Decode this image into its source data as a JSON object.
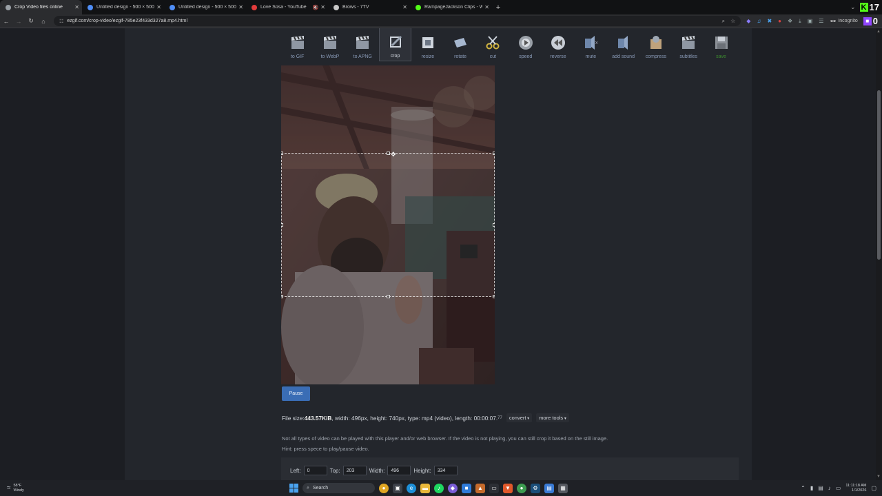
{
  "tabs": [
    {
      "label": "Crop Video files online",
      "favicon_color": "#9aa0a6",
      "active": true,
      "muted": false
    },
    {
      "label": "Untitled design - 500 × 500px",
      "favicon_color": "#4f8ef7",
      "active": false,
      "muted": false
    },
    {
      "label": "Untitled design - 500 × 500px",
      "favicon_color": "#4f8ef7",
      "active": false,
      "muted": false
    },
    {
      "label": "Love Sosa - YouTube",
      "favicon_color": "#e33b3b",
      "active": false,
      "muted": true
    },
    {
      "label": "Brows - 7TV",
      "favicon_color": "#c8c8c8",
      "active": false,
      "muted": false
    },
    {
      "label": "RampageJackson Clips - Watch",
      "favicon_color": "#53fc18",
      "active": false,
      "muted": false
    }
  ],
  "kick_count": "17",
  "address": {
    "url": "ezgif.com/crop-video/ezgif-785e23f433d327a8.mp4.html",
    "incognito_label": "Incognito",
    "twitch_count": "0"
  },
  "toolbar": {
    "tools": [
      {
        "label": "to GIF",
        "icon": "clapperboard-icon"
      },
      {
        "label": "to WebP",
        "icon": "clapperboard-icon"
      },
      {
        "label": "to APNG",
        "icon": "clapperboard-icon"
      },
      {
        "label": "crop",
        "icon": "crop-icon"
      },
      {
        "label": "resize",
        "icon": "resize-icon"
      },
      {
        "label": "rotate",
        "icon": "rotate-icon"
      },
      {
        "label": "cut",
        "icon": "scissors-icon"
      },
      {
        "label": "speed",
        "icon": "speed-icon"
      },
      {
        "label": "reverse",
        "icon": "rewind-icon"
      },
      {
        "label": "mute",
        "icon": "mute-icon"
      },
      {
        "label": "add sound",
        "icon": "speaker-icon"
      },
      {
        "label": "compress",
        "icon": "compress-icon"
      },
      {
        "label": "subtitles",
        "icon": "clapperboard-icon"
      },
      {
        "label": "save",
        "icon": "save-icon"
      }
    ]
  },
  "player": {
    "pause_label": "Pause"
  },
  "fileinfo": {
    "prefix": "File size: ",
    "size": "443.57KiB",
    "details": ", width: 496px, height: 740px, type: mp4 (video), length: 00:00:07.",
    "length_fraction": "77",
    "convert_label": "convert",
    "more_tools_label": "more tools"
  },
  "notes": {
    "line1": "Not all types of video can be played with this player and/or web browser. If the video is not playing, you can still crop it based on the still image.",
    "line2": "Hint: press spece to play/pause video."
  },
  "crop_form": {
    "left_label": "Left:",
    "left_value": "0",
    "top_label": "Top:",
    "top_value": "203",
    "width_label": "Width:",
    "width_value": "496",
    "height_label": "Height:",
    "height_value": "334"
  },
  "taskbar": {
    "weather_temp": "58°F",
    "weather_desc": "Windy",
    "search_label": "Search",
    "time": "11:11:18 AM",
    "date": "1/1/2026"
  },
  "colors": {
    "accent_blue": "#3a6db5",
    "save_green": "#3c8b2f",
    "page_bg": "#1c1e23",
    "content_bg": "#23262c"
  }
}
